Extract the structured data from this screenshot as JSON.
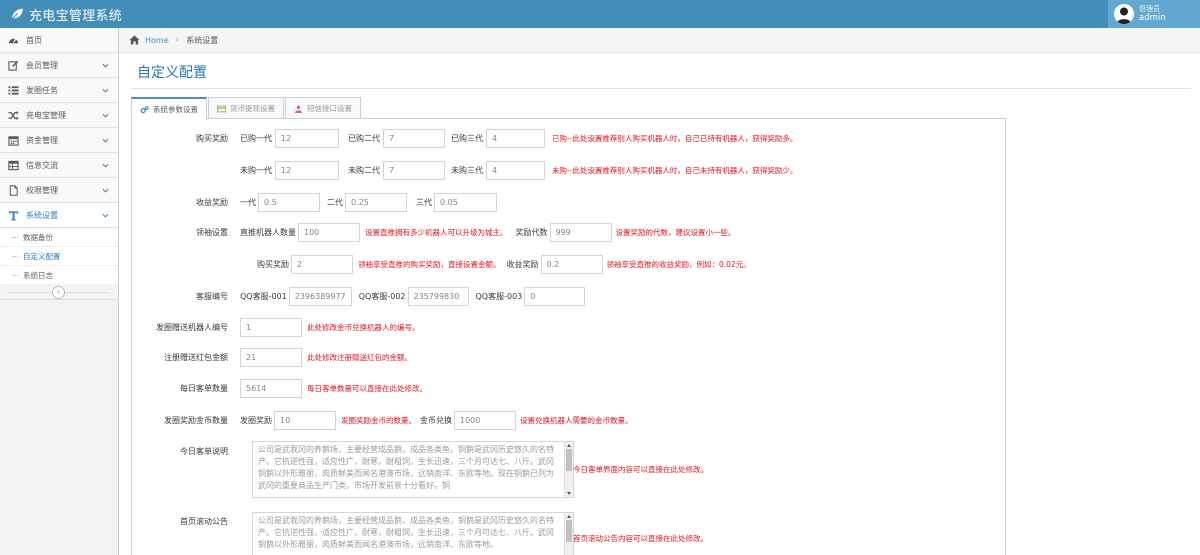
{
  "app": {
    "title": "充电宝管理系统"
  },
  "user": {
    "role": "管理员",
    "name": "admin"
  },
  "sidebar": {
    "items": [
      {
        "label": "首页",
        "icon": "dashboard-icon"
      },
      {
        "label": "会员管理",
        "icon": "edit-icon"
      },
      {
        "label": "发圈任务",
        "icon": "list-icon"
      },
      {
        "label": "充电宝管理",
        "icon": "shuffle-icon"
      },
      {
        "label": "资金管理",
        "icon": "calendar-icon"
      },
      {
        "label": "信息交流",
        "icon": "table-icon"
      },
      {
        "label": "权限管理",
        "icon": "file-icon"
      },
      {
        "label": "系统设置",
        "icon": "text-icon"
      }
    ],
    "subitems": [
      {
        "label": "数据备份"
      },
      {
        "label": "自定义配置"
      },
      {
        "label": "系统日志"
      }
    ],
    "collapse_label": "«"
  },
  "breadcrumb": {
    "home": "Home",
    "current": "系统设置"
  },
  "page": {
    "title": "自定义配置"
  },
  "tabs": [
    {
      "label": "系统参数设置"
    },
    {
      "label": "货币提现设置"
    },
    {
      "label": "短信接口设置"
    }
  ],
  "form": {
    "buy_reward": {
      "label": "购买奖励",
      "bought": {
        "l1": "已购一代",
        "v1": "12",
        "l2": "已购二代",
        "v2": "7",
        "l3": "已购三代",
        "v3": "4",
        "hint": "已购--此处设置推荐别人购买机器人时，自己已持有机器人，获得奖励多。"
      },
      "unbought": {
        "l1": "未购一代",
        "v1": "12",
        "l2": "未购二代",
        "v2": "7",
        "l3": "未购三代",
        "v3": "4",
        "hint": "未购--此处设置推荐别人购买机器人时，自己未持有机器人，获得奖励少。"
      }
    },
    "income_reward": {
      "label": "收益奖励",
      "l1": "一代",
      "v1": "0.5",
      "l2": "二代",
      "v2": "0.25",
      "l3": "三代",
      "v3": "0.05"
    },
    "leader": {
      "label": "领袖设置",
      "robots_label": "直推机器人数量",
      "robots_value": "100",
      "robots_hint": "设置直推拥有多少机器人可以升级为城主。",
      "gen_label": "奖励代数",
      "gen_value": "999",
      "gen_hint": "设置奖励的代数，建议设置小一些。",
      "buy_label": "购买奖励",
      "buy_value": "2",
      "buy_hint": "领袖享受直推的购买奖励，直接设置金额。",
      "income_label": "收益奖励",
      "income_value": "0.2",
      "income_hint": "领袖享受直推的收益奖励，例如：0.02元。"
    },
    "service": {
      "label": "客服编号",
      "l1": "QQ客服-001",
      "v1": "2396389977",
      "l2": "QQ客服-002",
      "v2": "235799830",
      "l3": "QQ客服-003",
      "v3": "0"
    },
    "gift_robot": {
      "label": "发圈赠送机器人编号",
      "value": "1",
      "hint": "此处修改金币兑换机器人的编号。"
    },
    "register_gift": {
      "label": "注册赠送红包金额",
      "value": "21",
      "hint": "此处修改注册赠送红包的金额。"
    },
    "daily_count": {
      "label": "每日客单数量",
      "value": "5614",
      "hint": "每日客单数量可以直接在此处修改。"
    },
    "coin_reward": {
      "label": "发圈奖励金币数量",
      "l1": "发圈奖励",
      "v1": "10",
      "hint1": "发圈奖励金币的数量。",
      "l2": "金币兑换",
      "v2": "1000",
      "hint2": "设置兑换机器人需要的金币数量。"
    },
    "daily_desc": {
      "label": "今日客单说明",
      "text": "公司是武我冈的养鹅场，主要经营成品鹅，成品各类鱼。铜鹅是武冈历史悠久的名特产。它抗逆性强，适应性广，耐寒，耐粗饲，生长迅速，三个月可达七、八斤。武冈铜鹅以外形雅丽，肉质鲜美而闻名港澳市场，远销南洋、东欧等地。现在铜鹅已列为武冈的重要商品生产门类，市场开发前景十分看好。铜",
      "hint": "今日客单界面内容可以直接在此处修改。"
    },
    "scroll_notice": {
      "label": "首页滚动公告",
      "text": "公司是武我冈的养鹅场，主要经营成品鹅，成品各类鱼。铜鹅是武冈历史悠久的名特产。它抗逆性强，适应性广，耐寒，耐粗饲，生长迅速，三个月可达七、八斤。武冈铜鹅以外形雅丽，肉质鲜美而闻名港澳市场，远销南洋、东欧等地。",
      "hint": "首页滚动公告内容可以直接在此处修改。"
    }
  },
  "colors": {
    "header": "#438eb9",
    "accent": "#2679b5",
    "hint": "#e4141b"
  }
}
